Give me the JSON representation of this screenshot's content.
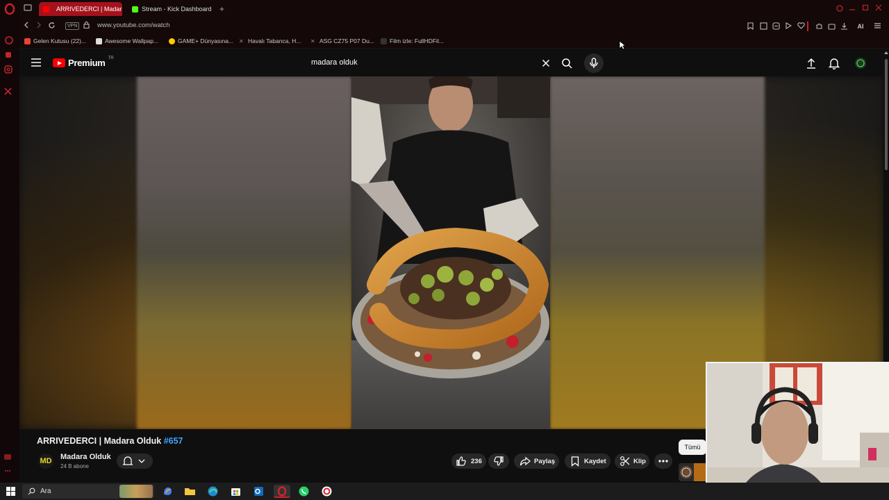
{
  "browser": {
    "tabs": [
      {
        "label": "ARRIVEDERCI | Madar",
        "active": true,
        "favicon_color": "#ff0000"
      },
      {
        "label": "Stream - Kick Dashboard",
        "active": false,
        "favicon_color": "#53fc18"
      }
    ],
    "new_tab_label": "+",
    "url": "www.youtube.com/watch",
    "vpn_label": "VPN",
    "ai_label": "AI",
    "bookmarks": [
      {
        "label": "Gelen Kutusu (22)...",
        "icon": "gmail-icon",
        "color": "#ea4335"
      },
      {
        "label": "Awesome Wallpap...",
        "icon": "wallpaper-icon",
        "color": "#dddddd"
      },
      {
        "label": "GAME+ Dünyasına...",
        "icon": "gameplus-icon",
        "color": "#ffcc00"
      },
      {
        "label": "Havalı Tabanca, H...",
        "icon": "gun-icon",
        "color": "#888888"
      },
      {
        "label": "ASG CZ75 P07 Du...",
        "icon": "gun-icon",
        "color": "#888888"
      },
      {
        "label": "Film izle: FullHDFil...",
        "icon": "film-icon",
        "color": "#333333"
      }
    ]
  },
  "youtube": {
    "brand": "Premium",
    "region": "TR",
    "search_query": "madara olduk",
    "video": {
      "title": "ARRIVEDERCI | Madara Olduk ",
      "hashtag": "#657",
      "channel_name": "Madara Olduk",
      "channel_avatar_text": "MD",
      "subscribers": "24 B abone",
      "likes": "236",
      "share_label": "Paylaş",
      "save_label": "Kaydet",
      "clip_label": "Klip"
    },
    "chip_all": "Tümü"
  },
  "taskbar": {
    "search_placeholder": "Ara"
  },
  "colors": {
    "accent": "#a4121c",
    "yt_red": "#ff0000",
    "link_blue": "#3ea6ff"
  }
}
